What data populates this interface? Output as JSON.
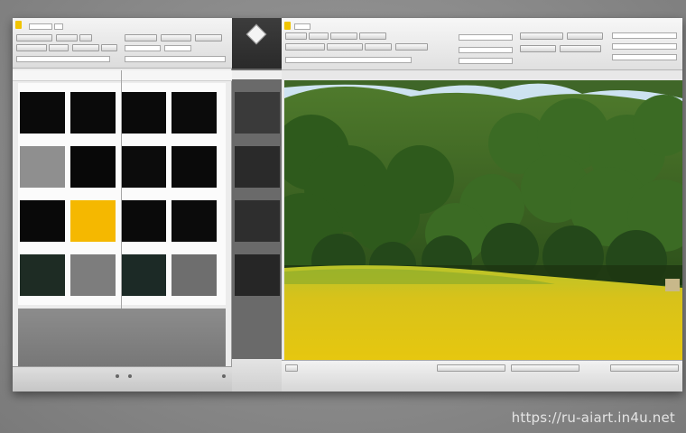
{
  "watermark": "https://ru-aiart.in4u.net",
  "colors": {
    "accent": "#f0c400",
    "swatch_yellow": "#f5b800",
    "swatch_black": "#0a0a0a",
    "swatch_gray": "#8f8f8f",
    "swatch_darkgreen": "#1e2c24"
  },
  "library": {
    "icon": "app-logo-icon",
    "thumbnails": [
      {
        "color": "#0a0a0a"
      },
      {
        "color": "#0a0a0a"
      },
      {
        "color": "#0a0a0a"
      },
      {
        "color": "#0b0b0b"
      },
      {
        "color": "#8f8f8f"
      },
      {
        "color": "#080808"
      },
      {
        "color": "#0c0c0c"
      },
      {
        "color": "#0a0a0a"
      },
      {
        "color": "#090909"
      },
      {
        "color": "#f5b800"
      },
      {
        "color": "#0a0a0a"
      },
      {
        "color": "#0b0b0b"
      },
      {
        "color": "#1e2c24"
      },
      {
        "color": "#7d7d7d"
      },
      {
        "color": "#1c2a26"
      },
      {
        "color": "#6e6e6e"
      }
    ]
  },
  "strip": {
    "icon": "diamond-icon",
    "thumbnails": [
      {
        "color": "#3a3a3a"
      },
      {
        "color": "#2a2a2a"
      },
      {
        "color": "#2e2e2e"
      },
      {
        "color": "#262626"
      }
    ]
  },
  "preview": {
    "scene": "landscape-photo"
  }
}
